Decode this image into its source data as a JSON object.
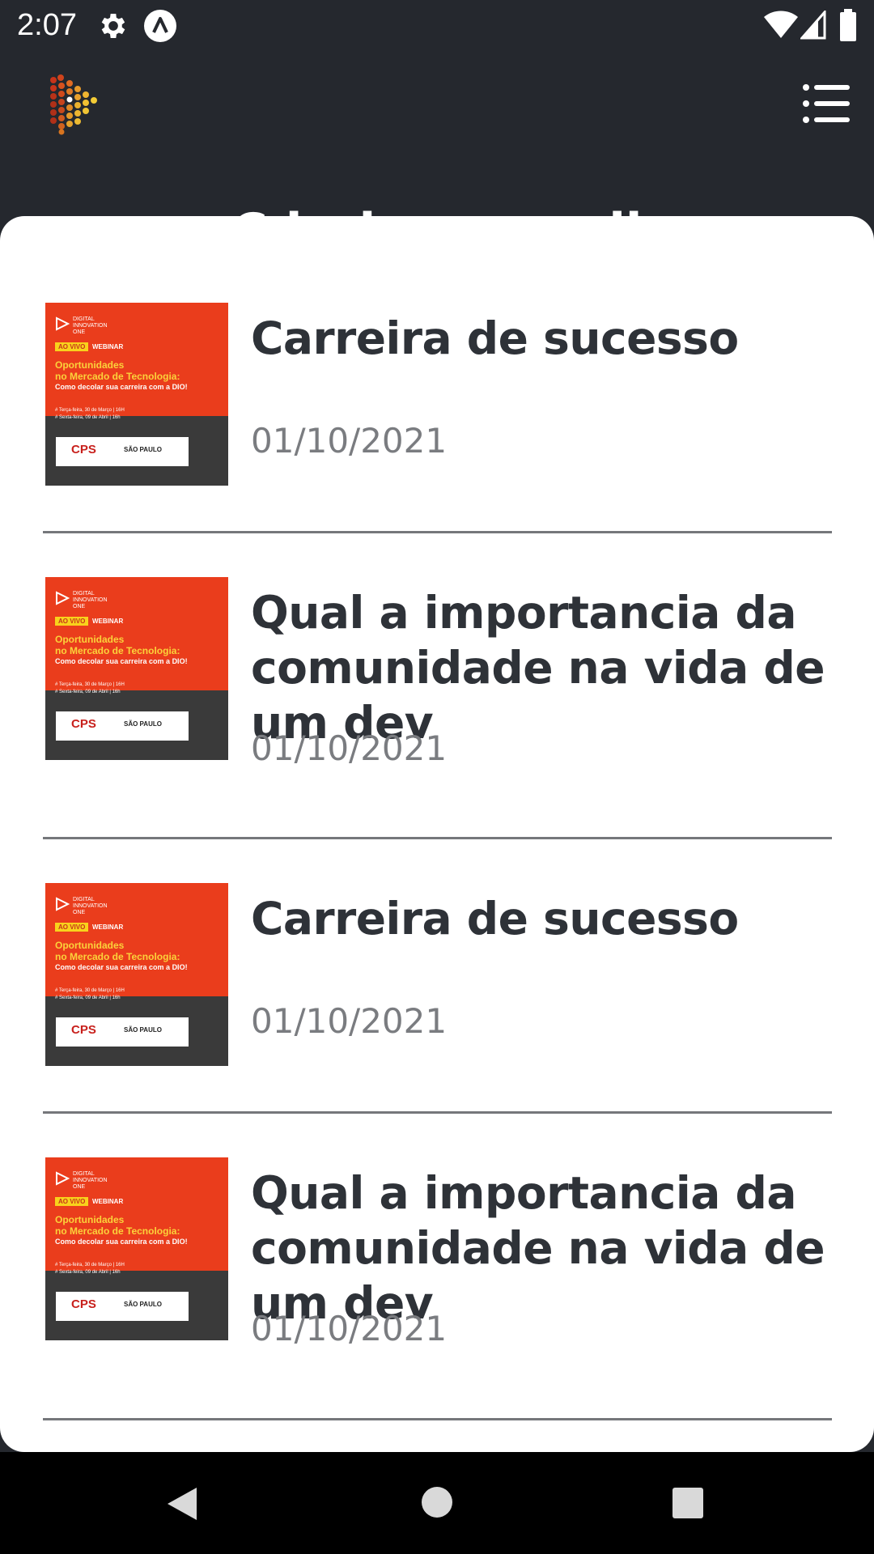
{
  "status_bar": {
    "time": "2:07",
    "icons": [
      "gear-icon",
      "app-a-icon",
      "wifi-icon",
      "signal-icon",
      "battery-icon"
    ]
  },
  "header": {
    "logo": "app-logo-icon",
    "menu_icon": "menu-icon",
    "partially_hidden_title": "Cdarian capudi"
  },
  "thumbnail": {
    "brand_line1": "DIGITAL",
    "brand_line2": "INNOVATION",
    "brand_line3": "ONE",
    "badge": "AO VIVO",
    "badge_suffix": "WEBINAR",
    "heading_line1": "Oportunidades",
    "heading_line2": "no Mercado de Tecnologia:",
    "subheading": "Como decolar sua carreira com a DIO!",
    "date_line1": "# Terça-feira, 30 de Março | 16H",
    "date_line2": "# Sexta-feira, 09 de Abril | 16h",
    "sponsor1": "CPS",
    "sponsor2": "SÃO PAULO"
  },
  "items": [
    {
      "title": "Carreira de sucesso",
      "date": "01/10/2021"
    },
    {
      "title": "Qual a importancia da comunidade na vida de um dev",
      "date": "01/10/2021"
    },
    {
      "title": "Carreira de sucesso",
      "date": "01/10/2021"
    },
    {
      "title": "Qual a importancia da comunidade na vida de um dev",
      "date": "01/10/2021"
    }
  ],
  "colors": {
    "header_bg": "#25282e",
    "sheet_bg": "#ffffff",
    "title_text": "#2e3238",
    "date_text": "#7a7c80",
    "divider": "#75777b",
    "thumb_orange": "#ea3d1c",
    "thumb_yellow": "#fbd23a"
  },
  "nav_bar": {
    "icons": [
      "back-icon",
      "home-icon",
      "recents-icon"
    ]
  }
}
